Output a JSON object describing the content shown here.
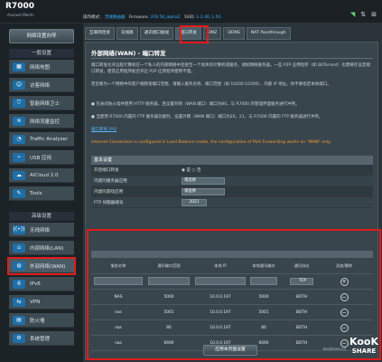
{
  "header": {
    "logo": "R7000",
    "model_line": "Asuswrt-Merlin",
    "status_label": "操作模式：",
    "mode_value": "无线路由器",
    "firmware_label": "Firmware:",
    "firmware_value": "378.56_alpha2",
    "ssid_label": "SSID:",
    "ssid_value": "1-2.4G  1-5G"
  },
  "sidebar": {
    "quick_setup": "网络设置向导",
    "general_header": "一般设置",
    "advanced_header": "高级设置",
    "items": [
      {
        "label": "网络地图",
        "icon": "network-map-icon",
        "glyph": "▦"
      },
      {
        "label": "访客网络",
        "icon": "guest-network-icon",
        "glyph": "☺"
      },
      {
        "label": "智能网络卫士",
        "icon": "shield-icon",
        "glyph": "⛉"
      },
      {
        "label": "网络流量监控",
        "icon": "traffic-icon",
        "glyph": "≋"
      },
      {
        "label": "Traffic Analyzer",
        "icon": "analyzer-icon",
        "glyph": "◔"
      },
      {
        "label": "USB 应用",
        "icon": "usb-icon",
        "glyph": "⌁"
      },
      {
        "label": "AiCloud 2.0",
        "icon": "cloud-icon",
        "glyph": "☁"
      },
      {
        "label": "Tools",
        "icon": "tools-icon",
        "glyph": "✎"
      }
    ],
    "advanced_items": [
      {
        "label": "无线网络",
        "icon": "wireless-icon",
        "glyph": "((•))"
      },
      {
        "label": "内部网络(LAN)",
        "icon": "lan-icon",
        "glyph": "⌂"
      },
      {
        "label": "外部网络(WAN)",
        "icon": "wan-icon",
        "glyph": "◍"
      },
      {
        "label": "IPv6",
        "icon": "ipv6-icon",
        "glyph": "6"
      },
      {
        "label": "VPN",
        "icon": "vpn-icon",
        "glyph": "⇆"
      },
      {
        "label": "防火墙",
        "icon": "firewall-icon",
        "glyph": "▤"
      },
      {
        "label": "系统管理",
        "icon": "admin-icon",
        "glyph": "⚙"
      }
    ]
  },
  "tabs": [
    "互联网连接",
    "双线路",
    "通讯端口触发",
    "端口转发",
    "DMZ",
    "DDNS",
    "NAT Passthrough"
  ],
  "active_tab": "端口转发",
  "page": {
    "title": "外部网络(WAN) - 端口转发",
    "desc1": "端口转发允许远程计算机在一个私人的内部网络中连接至一个具体的计算机或服务，诸如网络服务器。一些 P2P 应用程序（如 BitTorrent）也需要在设定端口转发，使其应用程序能否开启 P2P 应用程序使用不慢。",
    "desc2": "若您要为一个网络中的客户端转发端口范围，请输入服务名称、端口范围（如 10200:10300）、内部 IP 地址，你不要指定本地端口。",
    "bullet1": "● 在关闭防火墙并使用 HTTP 服务器，且设置外网（WAN 端口）端口为80，与 R7000 的管理界面服务进行冲突。",
    "bullet2": "● 当使用 R7000 内置的 FTP 服务器功能时，设置外网（WAN 端口）端口为20，21，与 R7000 内置的 FTP 服务器进行冲突。",
    "faq_link": "端口转发 FAQ",
    "warning": "Internet Connection is configured in Load Balance mode, the configuration of Port Forwarding works on \"WAN\" only."
  },
  "basic_settings": {
    "header": "基本设置",
    "rows": [
      {
        "label": "开启端口转发",
        "value": "是  ○ 否"
      },
      {
        "label": "内建的服务器应用",
        "value": "请选择"
      },
      {
        "label": "内建的游戏应用",
        "value": "请选择"
      },
      {
        "label": "FTP 伺服器端号",
        "value": "2021"
      }
    ]
  },
  "port_list": {
    "columns": [
      "服务名称",
      "通讯端口范围",
      "本地 IP",
      "本地通讯端口",
      "通讯协议",
      "添加/删除"
    ],
    "protocol_default": "TCP",
    "rows": [
      {
        "name": "NAS",
        "range": "5000",
        "ip": "10.0.0.197",
        "local": "5000",
        "proto": "BOTH"
      },
      {
        "name": "nas",
        "range": "5001",
        "ip": "10.0.0.197",
        "local": "5001",
        "proto": "BOTH"
      },
      {
        "name": "nas",
        "range": "80",
        "ip": "10.0.0.197",
        "local": "80",
        "proto": "BOTH"
      },
      {
        "name": "nas",
        "range": "6690",
        "ip": "10.0.0.197",
        "local": "6690",
        "proto": "BOTH"
      }
    ],
    "apply_label": "应用本页面设置"
  },
  "watermark": {
    "top": "KooK",
    "bottom": "SHARE",
    "url": "koolshare.cn"
  }
}
